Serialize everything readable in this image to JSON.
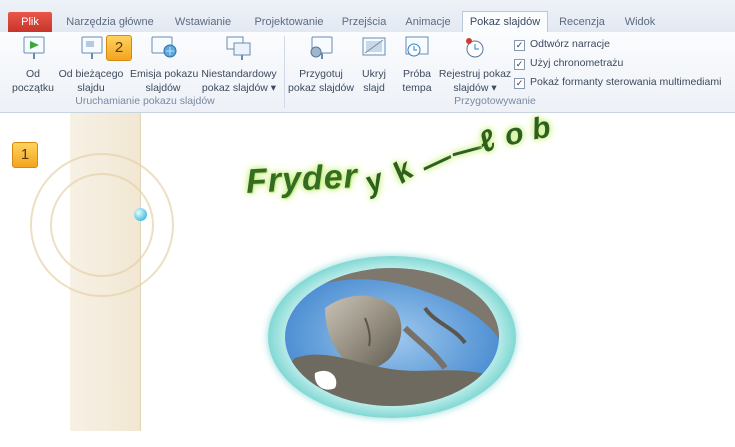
{
  "tabs": [
    {
      "label": "Plik"
    },
    {
      "label": "Narzędzia główne"
    },
    {
      "label": "Wstawianie"
    },
    {
      "label": "Projektowanie"
    },
    {
      "label": "Przejścia"
    },
    {
      "label": "Animacje"
    },
    {
      "label": "Pokaz slajdów"
    },
    {
      "label": "Recenzja"
    },
    {
      "label": "Widok"
    }
  ],
  "ribbon": {
    "start_group": {
      "label": "Uruchamianie pokazu slajdów",
      "buttons": [
        {
          "line1": "Od",
          "line2": "początku"
        },
        {
          "line1": "Od bieżącego",
          "line2": "slajdu"
        },
        {
          "line1": "Emisja pokazu",
          "line2": "slajdów"
        },
        {
          "line1": "Niestandardowy",
          "line2": "pokaz slajdów ▾"
        }
      ]
    },
    "setup_group": {
      "label": "Przygotowywanie",
      "buttons": [
        {
          "line1": "Przygotuj",
          "line2": "pokaz slajdów"
        },
        {
          "line1": "Ukryj",
          "line2": "slajd"
        },
        {
          "line1": "Próba",
          "line2": "tempa"
        },
        {
          "line1": "Rejestruj pokaz",
          "line2": "slajdów ▾"
        }
      ],
      "checkboxes": [
        {
          "label": "Odtwórz narracje",
          "checked": true
        },
        {
          "label": "Użyj chronometrażu",
          "checked": true
        },
        {
          "label": "Pokaż formanty sterowania multimediami",
          "checked": true
        }
      ]
    }
  },
  "badges": {
    "slide_badge": "1",
    "ribbon_badge": "2"
  },
  "slide": {
    "wordart_text": "Fryder",
    "wordart_wave": [
      "y",
      "k",
      "—",
      "—",
      "ℓ",
      "o",
      "b"
    ]
  },
  "colors": {
    "accent": "#c7342a",
    "wordart_glow": "#b7ec6a",
    "frame": "#4dc6c2",
    "badge": "#f3a41f"
  }
}
